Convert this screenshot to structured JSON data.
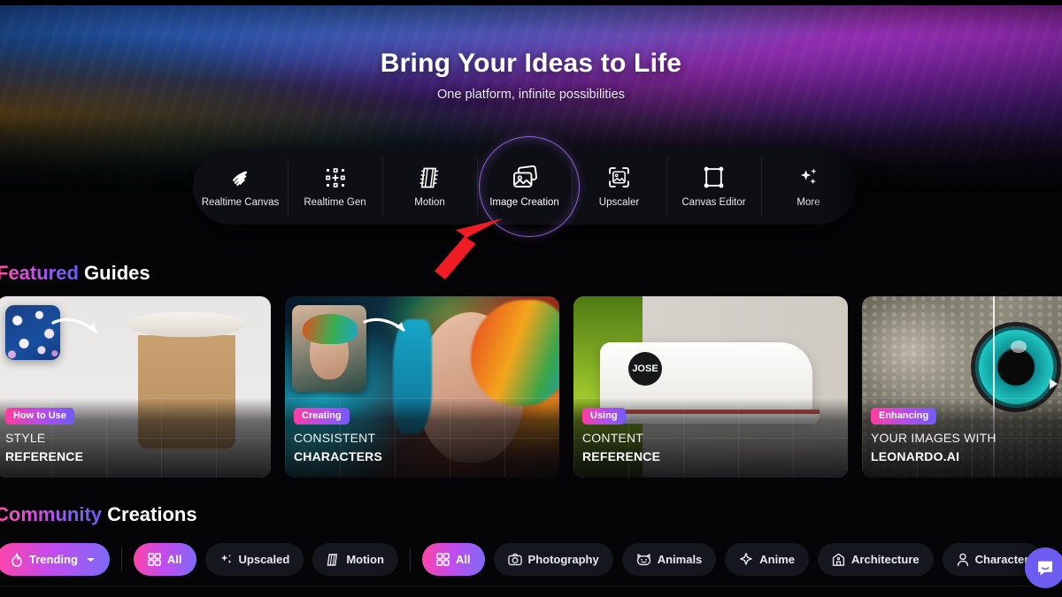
{
  "hero": {
    "title": "Bring Your Ideas to Life",
    "subtitle": "One platform, infinite possibilities"
  },
  "nav": {
    "items": [
      {
        "label": "Realtime Canvas",
        "icon": "realtime-canvas-icon",
        "active": false
      },
      {
        "label": "Realtime Gen",
        "icon": "realtime-gen-icon",
        "active": false
      },
      {
        "label": "Motion",
        "icon": "motion-film-icon",
        "active": false
      },
      {
        "label": "Image Creation",
        "icon": "image-creation-icon",
        "active": true
      },
      {
        "label": "Upscaler",
        "icon": "upscaler-icon",
        "active": false
      },
      {
        "label": "Canvas Editor",
        "icon": "canvas-editor-icon",
        "active": false
      },
      {
        "label": "More",
        "icon": "sparkles-icon",
        "active": false
      }
    ],
    "highlight_target": "Image Creation",
    "highlight_color": "#8d5fd6",
    "annotation_arrow_color": "#ef1c24"
  },
  "featured": {
    "title_accent": "Featured",
    "title_plain": "Guides",
    "cards": [
      {
        "badge": "How to Use",
        "line1": "STYLE",
        "line2": "REFERENCE",
        "art": "coffee-cup-floral-swatch"
      },
      {
        "badge": "Creating",
        "line1": "CONSISTENT",
        "line2": "CHARACTERS",
        "art": "rainbow-hair-portrait"
      },
      {
        "badge": "Using",
        "line1": "CONTENT",
        "line2": "REFERENCE",
        "art": "white-sneaker-jose"
      },
      {
        "badge": "Enhancing",
        "line1": "YOUR IMAGES WITH",
        "line2": "LEONARDO.AI",
        "art": "reptile-eye-closeup"
      }
    ],
    "next_arrow": "carousel-next-arrow"
  },
  "community": {
    "title_accent": "Community",
    "title_plain": "Creations",
    "sort": {
      "label": "Trending",
      "icon": "flame-icon",
      "caret": "chevron-down-icon",
      "active": true
    },
    "filters_primary": [
      {
        "label": "All",
        "icon": "grid-icon",
        "active": true
      },
      {
        "label": "Upscaled",
        "icon": "sparkle-icon",
        "active": false
      },
      {
        "label": "Motion",
        "icon": "motion-icon",
        "active": false
      }
    ],
    "filters_secondary": [
      {
        "label": "All",
        "icon": "grid-icon",
        "active": true
      },
      {
        "label": "Photography",
        "icon": "camera-icon",
        "active": false
      },
      {
        "label": "Animals",
        "icon": "cat-icon",
        "active": false
      },
      {
        "label": "Anime",
        "icon": "star-icon",
        "active": false
      },
      {
        "label": "Architecture",
        "icon": "building-icon",
        "active": false
      },
      {
        "label": "Character",
        "icon": "person-icon",
        "active": false
      }
    ]
  },
  "chat": {
    "icon": "chat-bubble-icon",
    "color": "#6d5cf0"
  },
  "colors": {
    "accent_pink": "#ff44a6",
    "accent_purple": "#8b5cf6",
    "accent_indigo": "#6d5cf0",
    "background": "#050507",
    "surface": "#15161e"
  }
}
